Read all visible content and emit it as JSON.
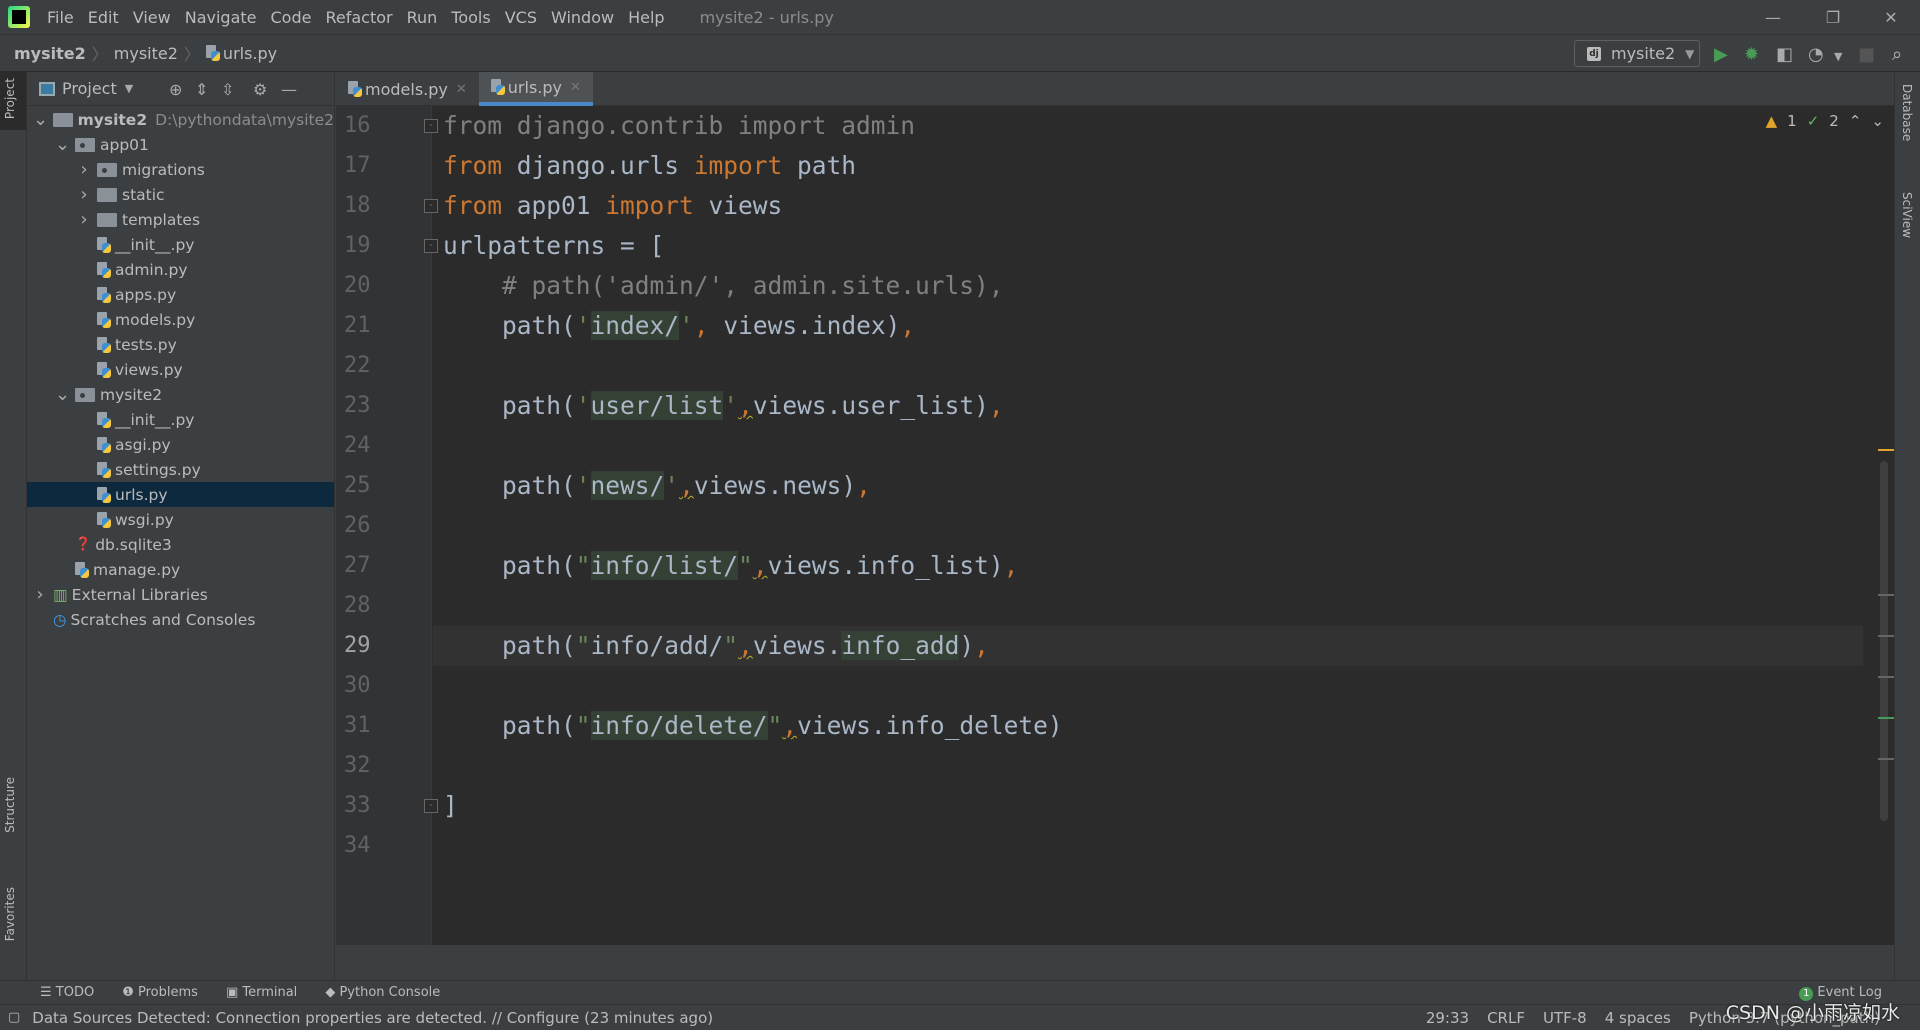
{
  "menu": [
    "File",
    "Edit",
    "View",
    "Navigate",
    "Code",
    "Refactor",
    "Run",
    "Tools",
    "VCS",
    "Window",
    "Help"
  ],
  "window_title": "mysite2 - urls.py",
  "breadcrumb": [
    "mysite2",
    "mysite2",
    "urls.py"
  ],
  "run_config": "mysite2",
  "left_stripe": {
    "project": "Project",
    "structure": "Structure",
    "favorites": "Favorites"
  },
  "right_stripe": {
    "database": "Database",
    "sciview": "SciView"
  },
  "project_panel": {
    "title": "Project"
  },
  "tree": [
    {
      "depth": 0,
      "type": "folder",
      "label": "mysite2",
      "path": "D:\\pythondata\\mysite2",
      "expanded": true,
      "bold": true
    },
    {
      "depth": 1,
      "type": "module",
      "label": "app01",
      "expanded": true
    },
    {
      "depth": 2,
      "type": "module",
      "label": "migrations",
      "expanded": false
    },
    {
      "depth": 2,
      "type": "folder",
      "label": "static",
      "expanded": false
    },
    {
      "depth": 2,
      "type": "folder",
      "label": "templates",
      "expanded": false
    },
    {
      "depth": 2,
      "type": "py",
      "label": "__init__.py"
    },
    {
      "depth": 2,
      "type": "py",
      "label": "admin.py"
    },
    {
      "depth": 2,
      "type": "py",
      "label": "apps.py"
    },
    {
      "depth": 2,
      "type": "py",
      "label": "models.py"
    },
    {
      "depth": 2,
      "type": "py",
      "label": "tests.py"
    },
    {
      "depth": 2,
      "type": "py",
      "label": "views.py"
    },
    {
      "depth": 1,
      "type": "module",
      "label": "mysite2",
      "expanded": true
    },
    {
      "depth": 2,
      "type": "py",
      "label": "__init__.py"
    },
    {
      "depth": 2,
      "type": "py",
      "label": "asgi.py"
    },
    {
      "depth": 2,
      "type": "py",
      "label": "settings.py"
    },
    {
      "depth": 2,
      "type": "py",
      "label": "urls.py",
      "selected": true
    },
    {
      "depth": 2,
      "type": "py",
      "label": "wsgi.py"
    },
    {
      "depth": 1,
      "type": "db",
      "label": "db.sqlite3"
    },
    {
      "depth": 1,
      "type": "py",
      "label": "manage.py"
    },
    {
      "depth": 0,
      "type": "lib",
      "label": "External Libraries",
      "expanded": false
    },
    {
      "depth": 0,
      "type": "scratch",
      "label": "Scratches and Consoles"
    }
  ],
  "tabs": [
    {
      "label": "models.py",
      "active": false
    },
    {
      "label": "urls.py",
      "active": true
    }
  ],
  "inspections": {
    "warnings": "1",
    "typos": "2"
  },
  "current_line": 29,
  "code": [
    {
      "n": "16",
      "fold": "-",
      "t": [
        [
          "dim",
          "from django.contrib import admin"
        ]
      ]
    },
    {
      "n": "17",
      "t": [
        [
          "kw",
          "from"
        ],
        [
          "id",
          " django.urls "
        ],
        [
          "kw",
          "import"
        ],
        [
          "id",
          " path"
        ]
      ]
    },
    {
      "n": "18",
      "fold": "-",
      "t": [
        [
          "kw",
          "from"
        ],
        [
          "id",
          " app01 "
        ],
        [
          "kw",
          "import"
        ],
        [
          "id",
          " views"
        ]
      ]
    },
    {
      "n": "19",
      "fold": "-",
      "t": [
        [
          "id",
          "urlpatterns = ["
        ]
      ]
    },
    {
      "n": "20",
      "t": [
        [
          "cm",
          "    # path('admin/', admin.site.urls),"
        ]
      ]
    },
    {
      "n": "21",
      "t": [
        [
          "id",
          "    path("
        ],
        [
          "str",
          "'"
        ],
        [
          "hl",
          "index/"
        ],
        [
          "str",
          "'"
        ],
        [
          "kw",
          ","
        ],
        [
          "id",
          " views.index)"
        ],
        [
          "kw",
          ","
        ]
      ]
    },
    {
      "n": "22",
      "t": []
    },
    {
      "n": "23",
      "t": [
        [
          "id",
          "    path("
        ],
        [
          "str",
          "'"
        ],
        [
          "hl",
          "user/list"
        ],
        [
          "str",
          "'"
        ],
        [
          "warn",
          ","
        ],
        [
          "id",
          "views.user_list)"
        ],
        [
          "kw",
          ","
        ]
      ]
    },
    {
      "n": "24",
      "t": []
    },
    {
      "n": "25",
      "t": [
        [
          "id",
          "    path("
        ],
        [
          "str",
          "'"
        ],
        [
          "hl",
          "news/"
        ],
        [
          "str",
          "'"
        ],
        [
          "warn",
          ","
        ],
        [
          "id",
          "views.news)"
        ],
        [
          "kw",
          ","
        ]
      ]
    },
    {
      "n": "26",
      "t": []
    },
    {
      "n": "27",
      "t": [
        [
          "id",
          "    path("
        ],
        [
          "str",
          "\""
        ],
        [
          "hl",
          "info/list/"
        ],
        [
          "str",
          "\""
        ],
        [
          "warn",
          ","
        ],
        [
          "id",
          "views.info_list)"
        ],
        [
          "kw",
          ","
        ]
      ]
    },
    {
      "n": "28",
      "t": []
    },
    {
      "n": "29",
      "t": [
        [
          "id",
          "    path("
        ],
        [
          "str",
          "\""
        ],
        [
          "id",
          "info/add/"
        ],
        [
          "str",
          "\""
        ],
        [
          "warn",
          ","
        ],
        [
          "id",
          "views."
        ],
        [
          "hl",
          "info_add"
        ],
        [
          "id",
          ")"
        ],
        [
          "kw",
          ","
        ]
      ]
    },
    {
      "n": "30",
      "t": []
    },
    {
      "n": "31",
      "t": [
        [
          "id",
          "    path("
        ],
        [
          "str",
          "\""
        ],
        [
          "hl",
          "info/delete/"
        ],
        [
          "str",
          "\""
        ],
        [
          "warn",
          ","
        ],
        [
          "id",
          "views.info_delete)"
        ]
      ]
    },
    {
      "n": "32",
      "t": []
    },
    {
      "n": "33",
      "fold": "-",
      "t": [
        [
          "id",
          "]"
        ]
      ]
    },
    {
      "n": "34",
      "t": []
    }
  ],
  "bottom_tools": [
    "TODO",
    "Problems",
    "Terminal",
    "Python Console"
  ],
  "event_log": {
    "label": "Event Log",
    "count": "1"
  },
  "status": {
    "message": "Data Sources Detected: Connection properties are detected. // Configure (23 minutes ago)",
    "position": "29:33",
    "line_sep": "CRLF",
    "encoding": "UTF-8",
    "indent": "4 spaces",
    "interpreter": "Python 3.7 (python_path)"
  },
  "watermark": "CSDN @小雨凉如水",
  "colors": {
    "keyword": "#cc7832",
    "string": "#6a8759",
    "text": "#a9b7c6",
    "comment": "#808080",
    "selection": "#0d293e",
    "accent": "#4a88c7"
  }
}
